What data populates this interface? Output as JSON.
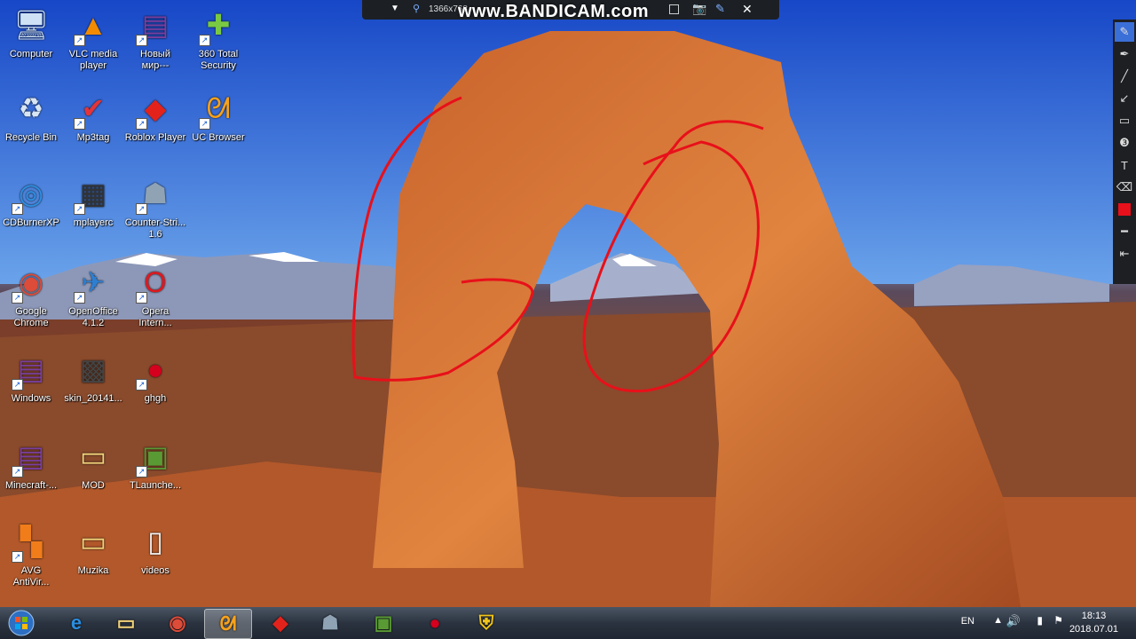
{
  "recorder": {
    "resolution": "1366x768",
    "watermark": "www.BANDICAM.com"
  },
  "desktop_icons": [
    {
      "label": "Computer",
      "icon": "computer-icon"
    },
    {
      "label": "VLC media\nplayer",
      "icon": "vlc-icon"
    },
    {
      "label": "Новый\nмир---",
      "icon": "winrar-icon"
    },
    {
      "label": "360 Total\nSecurity",
      "icon": "360-security-icon"
    },
    {
      "label": "Recycle Bin",
      "icon": "recycle-bin-icon"
    },
    {
      "label": "Mp3tag",
      "icon": "mp3tag-icon"
    },
    {
      "label": "Roblox Player",
      "icon": "roblox-icon"
    },
    {
      "label": "UC Browser",
      "icon": "uc-browser-icon"
    },
    {
      "label": "CDBurnerXP",
      "icon": "cdburner-icon"
    },
    {
      "label": "mplayerc",
      "icon": "mplayerc-icon"
    },
    {
      "label": "Counter-Stri...\n1.6",
      "icon": "counter-strike-icon"
    },
    {
      "label": "Google\nChrome",
      "icon": "chrome-icon"
    },
    {
      "label": "OpenOffice\n4.1.2",
      "icon": "openoffice-icon"
    },
    {
      "label": "Opera\nIntern...",
      "icon": "opera-icon"
    },
    {
      "label": "Windows",
      "icon": "winrar-icon"
    },
    {
      "label": "skin_20141...",
      "icon": "image-file-icon"
    },
    {
      "label": "ghgh",
      "icon": "bandicam-icon"
    },
    {
      "label": "Minecraft-...",
      "icon": "winrar-icon"
    },
    {
      "label": "MOD",
      "icon": "folder-icon"
    },
    {
      "label": "TLaunche...",
      "icon": "minecraft-icon"
    },
    {
      "label": "AVG\nAntiVir...",
      "icon": "avg-icon"
    },
    {
      "label": "Muzika",
      "icon": "folder-icon"
    },
    {
      "label": "videos",
      "icon": "file-icon"
    }
  ],
  "taskbar": {
    "start": "start-orb-icon",
    "pinned": [
      "internet-explorer-icon",
      "explorer-folder-icon",
      "chrome-icon",
      "uc-browser-icon",
      "roblox-icon",
      "counter-strike-icon",
      "minecraft-icon",
      "bandicam-icon",
      "security-shield-icon"
    ],
    "language": "EN",
    "time": "18:13",
    "date": "2018.07.01"
  },
  "colors": {
    "annotation_red": "#e8101a",
    "taskbar": "#2b3340",
    "uc_orange": "#f7a21b"
  }
}
